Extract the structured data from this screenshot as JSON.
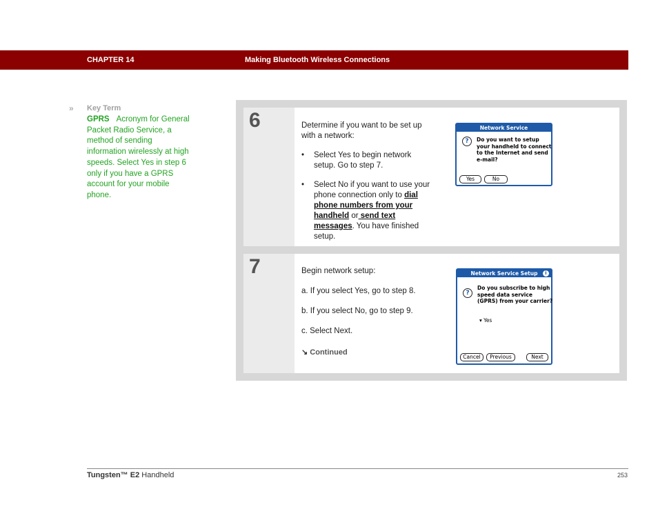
{
  "header": {
    "chapter": "CHAPTER 14",
    "title": "Making Bluetooth Wireless Connections",
    "bg_color": "#8b0000"
  },
  "sidebar": {
    "chevron": "»",
    "heading": "Key Term",
    "term": "GPRS",
    "definition": "Acronym for General Packet Radio Service, a method of sending information wirelessly at high speeds. Select Yes in step 6 only if you have a GPRS account for your mobile phone.",
    "text_color": "#22a322"
  },
  "steps": [
    {
      "number": "6",
      "intro": "Determine if you want to be set up with a network:",
      "bullets": [
        {
          "text": "Select Yes to begin network setup. Go to step 7."
        },
        {
          "pre": "Select No if you want to use your phone connection only to ",
          "link1": "dial phone numbers from your handheld",
          "mid": " or",
          "link2": " send text messages",
          "post": ". You have finished setup."
        }
      ],
      "dialog": {
        "title": "Network Service",
        "icon": "question-icon",
        "message": "Do you want to setup your handheld to connect to the Internet and send e-mail?",
        "buttons": [
          "Yes",
          "No"
        ]
      }
    },
    {
      "number": "7",
      "intro": "Begin network setup:",
      "items": [
        "a.  If you select Yes, go to step 8.",
        "b.  If you select No, go to step 9.",
        "c.  Select Next."
      ],
      "continued": "Continued",
      "dialog": {
        "title": "Network Service Setup",
        "icon": "question-icon",
        "message": "Do you subscribe to high speed data service (GPRS) from your carrier?",
        "dropdown": "Yes",
        "buttons": [
          "Cancel",
          "Previous",
          "Next"
        ]
      }
    }
  ],
  "footer": {
    "product": "Tungsten™",
    "model": "E2",
    "suffix": "Handheld",
    "page": "253"
  }
}
